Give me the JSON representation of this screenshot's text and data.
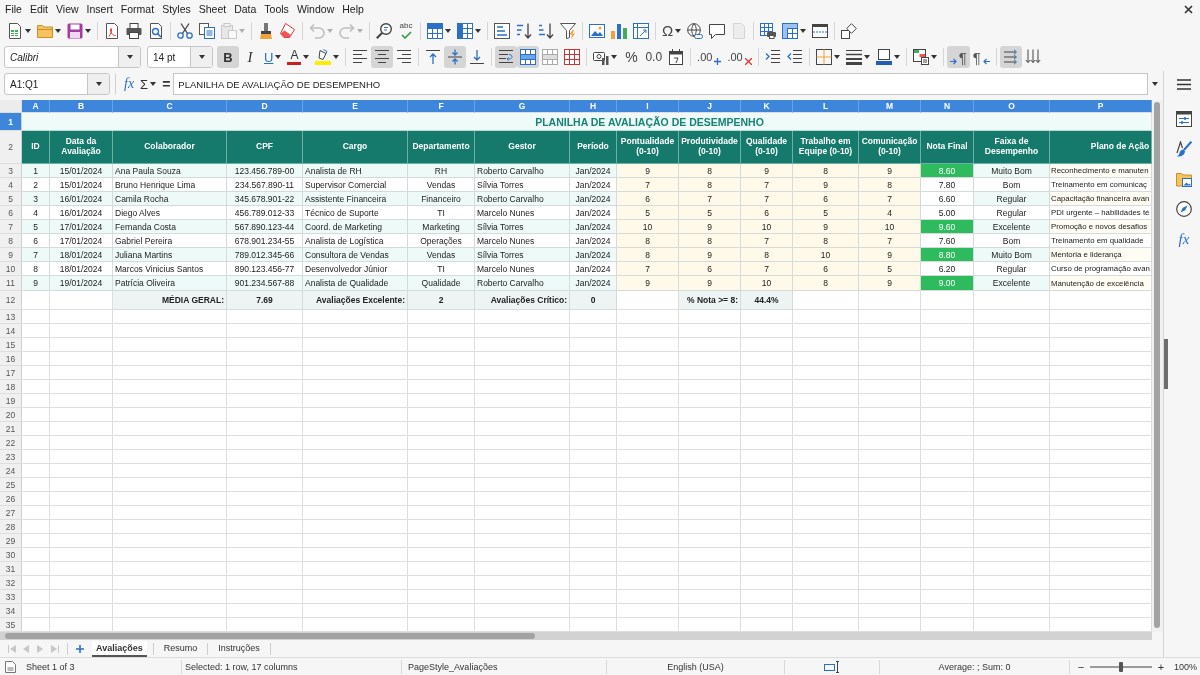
{
  "menu_bar": {
    "items": [
      "File",
      "Edit",
      "View",
      "Insert",
      "Format",
      "Styles",
      "Sheet",
      "Data",
      "Tools",
      "Window",
      "Help"
    ]
  },
  "standard_toolbar": {
    "buttons": [
      {
        "disabled": false
      },
      {
        "disabled": false
      },
      {
        "disabled": false
      },
      {
        "disabled": false
      },
      {
        "disabled": false
      },
      {
        "disabled": false
      },
      {
        "disabled": false
      },
      {
        "disabled": false
      },
      {
        "disabled": true
      },
      {
        "disabled": false
      },
      {
        "disabled": false
      },
      {
        "disabled": true
      },
      {
        "disabled": true
      },
      {
        "disabled": false
      },
      {
        "disabled": false,
        "glyph": "abc"
      },
      {
        "disabled": false
      },
      {
        "disabled": false
      },
      {
        "disabled": false
      },
      {
        "disabled": false
      },
      {
        "disabled": false
      },
      {
        "disabled": false
      },
      {
        "disabled": false
      },
      {
        "disabled": false
      },
      {
        "disabled": false
      },
      {
        "disabled": false,
        "glyph": "Ω"
      },
      {
        "disabled": false
      },
      {
        "disabled": false
      },
      {
        "disabled": true
      },
      {
        "disabled": false
      },
      {
        "disabled": false
      },
      {
        "disabled": false
      },
      {
        "disabled": false
      }
    ]
  },
  "formatting_toolbar": {
    "font_name": "Calibri",
    "font_size": "14 pt",
    "buttons": [
      {
        "pressed": true,
        "glyph": "B"
      },
      {
        "pressed": false,
        "glyph": "I"
      },
      {
        "pressed": false,
        "glyph": "U"
      },
      {
        "pressed": false,
        "glyph": "A"
      },
      {
        "pressed": false
      },
      {
        "pressed": false
      },
      {
        "pressed": true
      },
      {
        "pressed": false
      },
      {
        "pressed": false
      },
      {
        "pressed": true
      },
      {
        "pressed": false
      },
      {
        "pressed": true
      },
      {
        "pressed": true
      },
      {
        "pressed": false
      },
      {
        "pressed": false
      },
      {
        "pressed": false
      },
      {
        "pressed": false,
        "glyph": "%"
      },
      {
        "pressed": false,
        "glyph": "0.0"
      },
      {
        "pressed": false
      },
      {
        "pressed": false,
        "glyph": ".00"
      },
      {
        "pressed": false,
        "glyph": ".00"
      },
      {
        "pressed": false
      },
      {
        "pressed": false
      },
      {
        "pressed": false
      },
      {
        "pressed": false
      },
      {
        "pressed": false
      },
      {
        "pressed": false
      },
      {
        "pressed": true,
        "glyph": "¶"
      },
      {
        "pressed": false,
        "glyph": "¶"
      },
      {
        "pressed": true
      },
      {
        "pressed": false
      }
    ]
  },
  "formula_bar": {
    "name_box": "A1:Q1",
    "function_glyph": "fx",
    "sum_glyph": "Σ",
    "equals_glyph": "=",
    "content": "PLANILHA DE AVALIAÇÃO DE DESEMPENHO"
  },
  "sidebar": {
    "functions_glyph": "fx"
  },
  "sheet": {
    "columns": [
      {
        "label": "A",
        "selected": true
      },
      {
        "label": "B",
        "selected": true
      },
      {
        "label": "C",
        "selected": true
      },
      {
        "label": "D",
        "selected": true
      },
      {
        "label": "E",
        "selected": true
      },
      {
        "label": "F",
        "selected": true
      },
      {
        "label": "G",
        "selected": true
      },
      {
        "label": "H",
        "selected": true
      },
      {
        "label": "I",
        "selected": true
      },
      {
        "label": "J",
        "selected": true
      },
      {
        "label": "K",
        "selected": true
      },
      {
        "label": "L",
        "selected": true
      },
      {
        "label": "M",
        "selected": true
      },
      {
        "label": "N",
        "selected": true
      },
      {
        "label": "O",
        "selected": true
      },
      {
        "label": "P",
        "selected": true
      }
    ],
    "rows": [
      {
        "label": "1",
        "selected": true
      },
      {
        "label": "2",
        "selected": false
      },
      {
        "label": "3",
        "selected": false
      },
      {
        "label": "4",
        "selected": false
      },
      {
        "label": "5",
        "selected": false
      },
      {
        "label": "6",
        "selected": false
      },
      {
        "label": "7",
        "selected": false
      },
      {
        "label": "8",
        "selected": false
      },
      {
        "label": "9",
        "selected": false
      },
      {
        "label": "10",
        "selected": false
      },
      {
        "label": "11",
        "selected": false
      },
      {
        "label": "12",
        "selected": false
      },
      {
        "label": "13",
        "selected": false
      },
      {
        "label": "14",
        "selected": false
      },
      {
        "label": "15",
        "selected": false
      },
      {
        "label": "16",
        "selected": false
      },
      {
        "label": "17",
        "selected": false
      },
      {
        "label": "18",
        "selected": false
      },
      {
        "label": "19",
        "selected": false
      },
      {
        "label": "20",
        "selected": false
      },
      {
        "label": "21",
        "selected": false
      },
      {
        "label": "22",
        "selected": false
      },
      {
        "label": "23",
        "selected": false
      },
      {
        "label": "24",
        "selected": false
      },
      {
        "label": "25",
        "selected": false
      },
      {
        "label": "26",
        "selected": false
      },
      {
        "label": "27",
        "selected": false
      },
      {
        "label": "28",
        "selected": false
      },
      {
        "label": "29",
        "selected": false
      },
      {
        "label": "30",
        "selected": false
      },
      {
        "label": "31",
        "selected": false
      },
      {
        "label": "32",
        "selected": false
      },
      {
        "label": "33",
        "selected": false
      },
      {
        "label": "34",
        "selected": false
      },
      {
        "label": "35",
        "selected": false
      }
    ],
    "title": "PLANILHA DE AVALIAÇÃO DE DESEMPENHO",
    "headers": [
      "ID",
      "Data da Avaliação",
      "Colaborador",
      "CPF",
      "Cargo",
      "Departamento",
      "Gestor",
      "Período",
      "Pontualidade (0-10)",
      "Produtividade (0-10)",
      "Qualidade (0-10)",
      "Trabalho em Equipe (0-10)",
      "Comunicação (0-10)",
      "Nota Final",
      "Faixa de Desempenho",
      "Plano de Ação"
    ],
    "records": [
      {
        "id": "1",
        "date": "15/01/2024",
        "employee": "Ana Paula Souza",
        "cpf": "123.456.789-00",
        "role": "Analista de RH",
        "department": "RH",
        "manager": "Roberto Carvalho",
        "period": "Jan/2024",
        "punctuality": "9",
        "productivity": "8",
        "quality": "9",
        "teamwork": "8",
        "communication": "9",
        "final_score": "8.60",
        "final_score_highlighted": true,
        "band": "Muito Bom",
        "action_plan": "Reconhecimento e manuten"
      },
      {
        "id": "2",
        "date": "15/01/2024",
        "employee": "Bruno Henrique Lima",
        "cpf": "234.567.890-11",
        "role": "Supervisor Comercial",
        "department": "Vendas",
        "manager": "Sílvia Torres",
        "period": "Jan/2024",
        "punctuality": "7",
        "productivity": "8",
        "quality": "7",
        "teamwork": "9",
        "communication": "8",
        "final_score": "7.80",
        "final_score_highlighted": false,
        "band": "Bom",
        "action_plan": "Treinamento em comunicaç"
      },
      {
        "id": "3",
        "date": "16/01/2024",
        "employee": "Camila Rocha",
        "cpf": "345.678.901-22",
        "role": "Assistente Financeira",
        "department": "Financeiro",
        "manager": "Roberto Carvalho",
        "period": "Jan/2024",
        "punctuality": "6",
        "productivity": "7",
        "quality": "7",
        "teamwork": "6",
        "communication": "7",
        "final_score": "6.60",
        "final_score_highlighted": false,
        "band": "Regular",
        "action_plan": "Capacitação financeira avan"
      },
      {
        "id": "4",
        "date": "16/01/2024",
        "employee": "Diego Alves",
        "cpf": "456.789.012-33",
        "role": "Técnico de Suporte",
        "department": "TI",
        "manager": "Marcelo Nunes",
        "period": "Jan/2024",
        "punctuality": "5",
        "productivity": "5",
        "quality": "6",
        "teamwork": "5",
        "communication": "4",
        "final_score": "5.00",
        "final_score_highlighted": false,
        "band": "Regular",
        "action_plan": "PDI urgente – habilidades té"
      },
      {
        "id": "5",
        "date": "17/01/2024",
        "employee": "Fernanda Costa",
        "cpf": "567.890.123-44",
        "role": "Coord. de Marketing",
        "department": "Marketing",
        "manager": "Sílvia Torres",
        "period": "Jan/2024",
        "punctuality": "10",
        "productivity": "9",
        "quality": "10",
        "teamwork": "9",
        "communication": "10",
        "final_score": "9.60",
        "final_score_highlighted": true,
        "band": "Excelente",
        "action_plan": "Promoção e novos desafios"
      },
      {
        "id": "6",
        "date": "17/01/2024",
        "employee": "Gabriel Pereira",
        "cpf": "678.901.234-55",
        "role": "Analista de Logística",
        "department": "Operações",
        "manager": "Marcelo Nunes",
        "period": "Jan/2024",
        "punctuality": "8",
        "productivity": "8",
        "quality": "7",
        "teamwork": "8",
        "communication": "7",
        "final_score": "7.60",
        "final_score_highlighted": false,
        "band": "Bom",
        "action_plan": "Treinamento em qualidade"
      },
      {
        "id": "7",
        "date": "18/01/2024",
        "employee": "Juliana Martins",
        "cpf": "789.012.345-66",
        "role": "Consultora de Vendas",
        "department": "Vendas",
        "manager": "Sílvia Torres",
        "period": "Jan/2024",
        "punctuality": "8",
        "productivity": "9",
        "quality": "8",
        "teamwork": "10",
        "communication": "9",
        "final_score": "8.80",
        "final_score_highlighted": true,
        "band": "Muito Bom",
        "action_plan": "Mentoria e liderança"
      },
      {
        "id": "8",
        "date": "18/01/2024",
        "employee": "Marcos Vinicius Santos",
        "cpf": "890.123.456-77",
        "role": "Desenvolvedor Júnior",
        "department": "TI",
        "manager": "Marcelo Nunes",
        "period": "Jan/2024",
        "punctuality": "7",
        "productivity": "6",
        "quality": "7",
        "teamwork": "6",
        "communication": "5",
        "final_score": "6.20",
        "final_score_highlighted": false,
        "band": "Regular",
        "action_plan": "Curso de programação avan"
      },
      {
        "id": "9",
        "date": "19/01/2024",
        "employee": "Patrícia Oliveira",
        "cpf": "901.234.567-88",
        "role": "Analista de Qualidade",
        "department": "Qualidade",
        "manager": "Roberto Carvalho",
        "period": "Jan/2024",
        "punctuality": "9",
        "productivity": "9",
        "quality": "10",
        "teamwork": "8",
        "communication": "9",
        "final_score": "9.00",
        "final_score_highlighted": true,
        "band": "Excelente",
        "action_plan": "Manutenção de excelência"
      }
    ],
    "summary": [
      {
        "label": "MÉDIA GERAL:",
        "value": "7.69"
      },
      {
        "label": "Avaliações Excelente:",
        "value": "2"
      },
      {
        "label": "Avaliações Crítico:",
        "value": "0"
      },
      {
        "label": "% Nota >= 8:",
        "value": "44.4%"
      }
    ]
  },
  "sheet_navigation": [
    {
      "disabled": true
    },
    {
      "disabled": true
    },
    {
      "disabled": true
    },
    {
      "disabled": true
    }
  ],
  "sheet_tabs": [
    {
      "label": "Avaliações",
      "selected": true
    },
    {
      "label": "Resumo",
      "selected": false
    },
    {
      "label": "Instruções",
      "selected": false
    }
  ],
  "status_bar": {
    "sheet": "Sheet 1 of 3",
    "selection": "Selected: 1 row, 17 columns",
    "page_style": "PageStyle_Avaliações",
    "language": "English (USA)",
    "sum": "Average: ; Sum: 0",
    "zoom_out": "−",
    "zoom_in": "+",
    "zoom": {
      "level": 0.5
    },
    "zoom_reading": "100%"
  }
}
